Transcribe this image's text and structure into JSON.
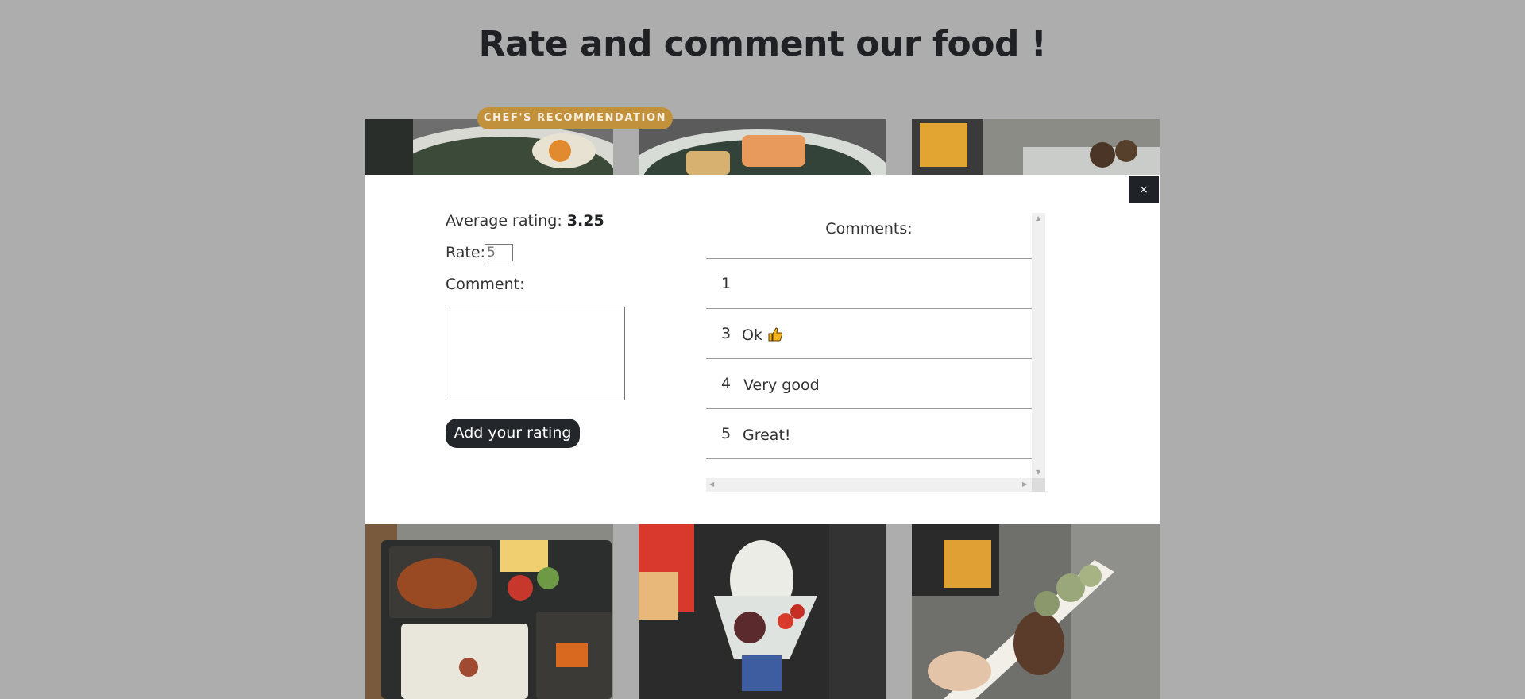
{
  "page": {
    "title": "Rate and comment our food !"
  },
  "gallery": {
    "badge": "CHEF'S RECOMMENDATION",
    "cards": [
      {
        "name": "card-ramen"
      },
      {
        "name": "card-salmon-bowl"
      },
      {
        "name": "card-grilled-skewers"
      },
      {
        "name": "card-bento"
      },
      {
        "name": "card-shaved-ice"
      },
      {
        "name": "card-matcha-dessert"
      }
    ]
  },
  "modal": {
    "close_label": "×",
    "average_label": "Average rating:",
    "average_value": "3.25",
    "rate_label": "Rate:",
    "rate_placeholder": "5",
    "comment_label": "Comment:",
    "submit_label": "Add your rating",
    "comments_heading": "Comments:",
    "comments": [
      {
        "rating": "1",
        "text": ""
      },
      {
        "rating": "3",
        "text": "Ok",
        "icon": "thumbs-up-icon"
      },
      {
        "rating": "4",
        "text": "Very good"
      },
      {
        "rating": "5",
        "text": "Great!"
      }
    ]
  }
}
